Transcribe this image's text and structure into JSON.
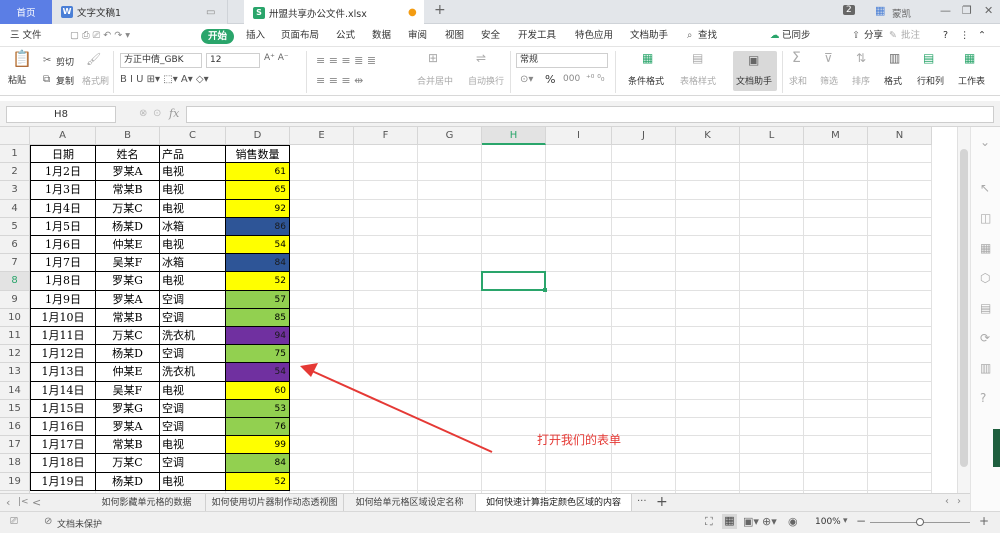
{
  "tabs": {
    "home": "首页",
    "doc": "文字文稿1",
    "xls": "卅盟共享办公文件.xlsx",
    "new_tab": "+",
    "badge": "2",
    "user": "蒙凯"
  },
  "menu": {
    "file": "三 文件",
    "items": [
      "开始",
      "插入",
      "页面布局",
      "公式",
      "数据",
      "审阅",
      "视图",
      "安全",
      "开发工具",
      "特色应用",
      "文档助手"
    ],
    "search": "查找",
    "sync": "已同步",
    "share": "分享",
    "comment": "批注"
  },
  "ribbon": {
    "paste": "粘贴",
    "cut": "剪切",
    "copy": "复制",
    "format_painter": "格式刷",
    "font_name": "方正中倩_GBK",
    "font_size": "12",
    "merge": "合并居中",
    "wrap": "自动换行",
    "number_format": "常规",
    "percent": "%",
    "thousands": "000",
    "cond_format": "条件格式",
    "table_style": "表格样式",
    "doc_assistant": "文档助手",
    "sum": "求和",
    "filter": "筛选",
    "sort": "排序",
    "format": "格式",
    "rows_cols": "行和列",
    "worksheet": "工作表"
  },
  "formula_bar": {
    "name_box": "H8",
    "fx": "fx",
    "content": ""
  },
  "columns": [
    "A",
    "B",
    "C",
    "D",
    "E",
    "F",
    "G",
    "H",
    "I",
    "J",
    "K",
    "L",
    "M",
    "N"
  ],
  "selected_column": "H",
  "selected_row": 8,
  "rows": [
    {
      "n": 1,
      "a": "日期",
      "b": "姓名",
      "c": "产品",
      "d": "销售数量",
      "fill": ""
    },
    {
      "n": 2,
      "a": "1月2日",
      "b": "罗某A",
      "c": "电视",
      "d": "61",
      "fill": "#ffff00"
    },
    {
      "n": 3,
      "a": "1月3日",
      "b": "常某B",
      "c": "电视",
      "d": "65",
      "fill": "#ffff00"
    },
    {
      "n": 4,
      "a": "1月4日",
      "b": "万某C",
      "c": "电视",
      "d": "92",
      "fill": "#ffff00"
    },
    {
      "n": 5,
      "a": "1月5日",
      "b": "杨某D",
      "c": "冰箱",
      "d": "86",
      "fill": "#2e5597"
    },
    {
      "n": 6,
      "a": "1月6日",
      "b": "仲某E",
      "c": "电视",
      "d": "54",
      "fill": "#ffff00"
    },
    {
      "n": 7,
      "a": "1月7日",
      "b": "吴某F",
      "c": "冰箱",
      "d": "84",
      "fill": "#2e5597"
    },
    {
      "n": 8,
      "a": "1月8日",
      "b": "罗某G",
      "c": "电视",
      "d": "52",
      "fill": "#ffff00"
    },
    {
      "n": 9,
      "a": "1月9日",
      "b": "罗某A",
      "c": "空调",
      "d": "57",
      "fill": "#92d050"
    },
    {
      "n": 10,
      "a": "1月10日",
      "b": "常某B",
      "c": "空调",
      "d": "85",
      "fill": "#92d050"
    },
    {
      "n": 11,
      "a": "1月11日",
      "b": "万某C",
      "c": "洗衣机",
      "d": "94",
      "fill": "#7030a0"
    },
    {
      "n": 12,
      "a": "1月12日",
      "b": "杨某D",
      "c": "空调",
      "d": "75",
      "fill": "#92d050"
    },
    {
      "n": 13,
      "a": "1月13日",
      "b": "仲某E",
      "c": "洗衣机",
      "d": "54",
      "fill": "#7030a0"
    },
    {
      "n": 14,
      "a": "1月14日",
      "b": "吴某F",
      "c": "电视",
      "d": "60",
      "fill": "#ffff00"
    },
    {
      "n": 15,
      "a": "1月15日",
      "b": "罗某G",
      "c": "空调",
      "d": "53",
      "fill": "#92d050"
    },
    {
      "n": 16,
      "a": "1月16日",
      "b": "罗某A",
      "c": "空调",
      "d": "76",
      "fill": "#92d050"
    },
    {
      "n": 17,
      "a": "1月17日",
      "b": "常某B",
      "c": "电视",
      "d": "99",
      "fill": "#ffff00"
    },
    {
      "n": 18,
      "a": "1月18日",
      "b": "万某C",
      "c": "空调",
      "d": "84",
      "fill": "#92d050"
    },
    {
      "n": 19,
      "a": "1月19日",
      "b": "杨某D",
      "c": "电视",
      "d": "52",
      "fill": "#ffff00"
    }
  ],
  "sheets": {
    "items": [
      "如何影藏单元格的数据",
      "如何使用切片器制作动态透视图",
      "如何给单元格区域设定名称",
      "如何快速计算指定颜色区域的内容"
    ],
    "active_index": 3,
    "more": "···",
    "add": "+"
  },
  "status": {
    "protect": "文档未保护",
    "zoom": "100%",
    "zoom_fraction": 0.5
  },
  "annotation": {
    "text": "打开我们的表单",
    "color": "#e53935"
  }
}
